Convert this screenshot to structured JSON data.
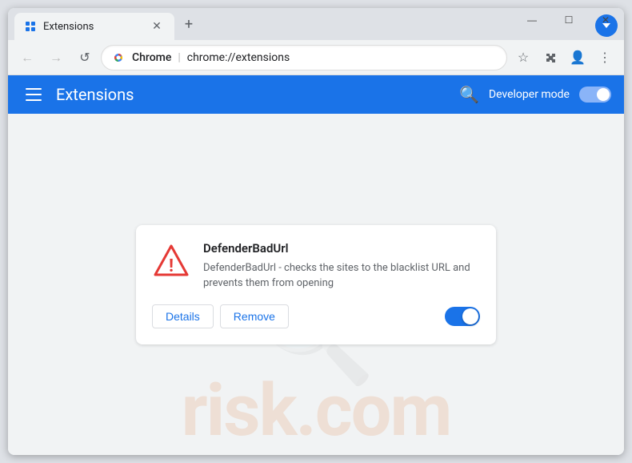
{
  "window": {
    "title": "Extensions",
    "tab_title": "Extensions",
    "url_site": "Chrome",
    "url_full": "chrome://extensions",
    "controls": {
      "minimize": "—",
      "maximize": "☐",
      "close": "✕"
    }
  },
  "navbar": {
    "back_label": "←",
    "forward_label": "→",
    "refresh_label": "↺"
  },
  "extensions_bar": {
    "title": "Extensions",
    "search_label": "🔍",
    "developer_mode_label": "Developer mode"
  },
  "extension_card": {
    "name": "DefenderBadUrl",
    "description": "DefenderBadUrl - checks the sites to the blacklist URL and prevents them from opening",
    "details_label": "Details",
    "remove_label": "Remove",
    "enabled": true
  },
  "watermark": {
    "logo": "🔍",
    "text": "risk.com"
  },
  "new_tab_label": "+",
  "profile_label": "▼"
}
